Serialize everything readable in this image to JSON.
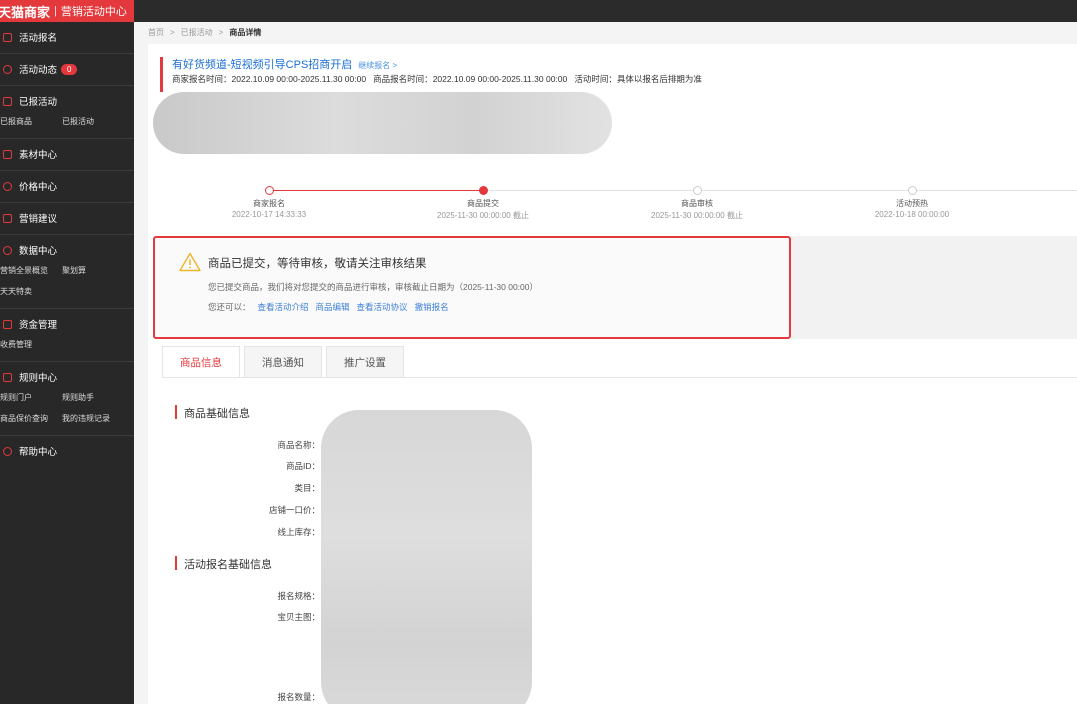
{
  "brand": {
    "logo": "天猫商家",
    "separator": "|",
    "subtitle": "营销活动中心"
  },
  "sidebar": {
    "groups": [
      {
        "label": "活动报名",
        "icon": "signup-icon",
        "subs": []
      },
      {
        "label": "活动动态",
        "icon": "eye-icon",
        "badge": "0",
        "subs": []
      },
      {
        "label": "已报活动",
        "icon": "list-icon",
        "subs": [
          "已报商品",
          "已报活动"
        ]
      },
      {
        "label": "素材中心",
        "icon": "material-icon",
        "subs": []
      },
      {
        "label": "价格中心",
        "icon": "price-icon",
        "subs": []
      },
      {
        "label": "营销建议",
        "icon": "suggestion-icon",
        "subs": []
      },
      {
        "label": "数据中心",
        "icon": "data-icon",
        "subs": [
          "营销全景概览",
          "聚划算",
          "天天特卖"
        ]
      },
      {
        "label": "资金管理",
        "icon": "fund-icon",
        "subs": [
          "收费管理"
        ]
      },
      {
        "label": "规则中心",
        "icon": "rules-icon",
        "subs": [
          "规则门户",
          "规则助手",
          "商品保价查询",
          "我的违规记录"
        ]
      },
      {
        "label": "帮助中心",
        "icon": "help-icon",
        "subs": []
      }
    ]
  },
  "breadcrumb": {
    "home": "首页",
    "sep": ">",
    "reported": "已报活动",
    "current": "商品详情"
  },
  "activity": {
    "title": "有好货频道-短视频引导CPS招商开启",
    "continue_link": "继续报名 >",
    "merchant_time_label": "商家报名时间：",
    "merchant_time": "2022.10.09 00:00-2025.11.30 00:00",
    "product_time_label": "商品报名时间：",
    "product_time": "2022.10.09 00:00-2025.11.30 00:00",
    "activity_time_label": "活动时间：",
    "activity_time": "具体以报名后排期为准"
  },
  "steps": [
    {
      "label": "商家报名",
      "time": "2022-10-17 14:33:33"
    },
    {
      "label": "商品提交",
      "time": "2025-11-30 00:00:00 截止"
    },
    {
      "label": "商品审核",
      "time": "2025-11-30 00:00:00 截止"
    },
    {
      "label": "活动预热",
      "time": "2022-10-18 00:00:00"
    }
  ],
  "notice": {
    "title": "商品已提交，等待审核，敬请关注审核结果",
    "desc": "您已提交商品，我们将对您提交的商品进行审核，审核截止日期为（2025-11-30 00:00）",
    "actions_label": "您还可以：",
    "actions": [
      "查看活动介绍",
      "商品编辑",
      "查看活动协议",
      "撤销报名"
    ]
  },
  "tabs": [
    "商品信息",
    "消息通知",
    "推广设置"
  ],
  "product_section": {
    "title": "商品基础信息",
    "fields": [
      "商品名称：",
      "商品ID：",
      "类目：",
      "店铺一口价：",
      "线上库存："
    ]
  },
  "signup_section": {
    "title": "活动报名基础信息",
    "fields": [
      "报名规格：",
      "宝贝主图：",
      "报名数量："
    ]
  },
  "colors": {
    "accent": "#e4393c",
    "link": "#3d7fd8",
    "sidebar": "#282828"
  }
}
